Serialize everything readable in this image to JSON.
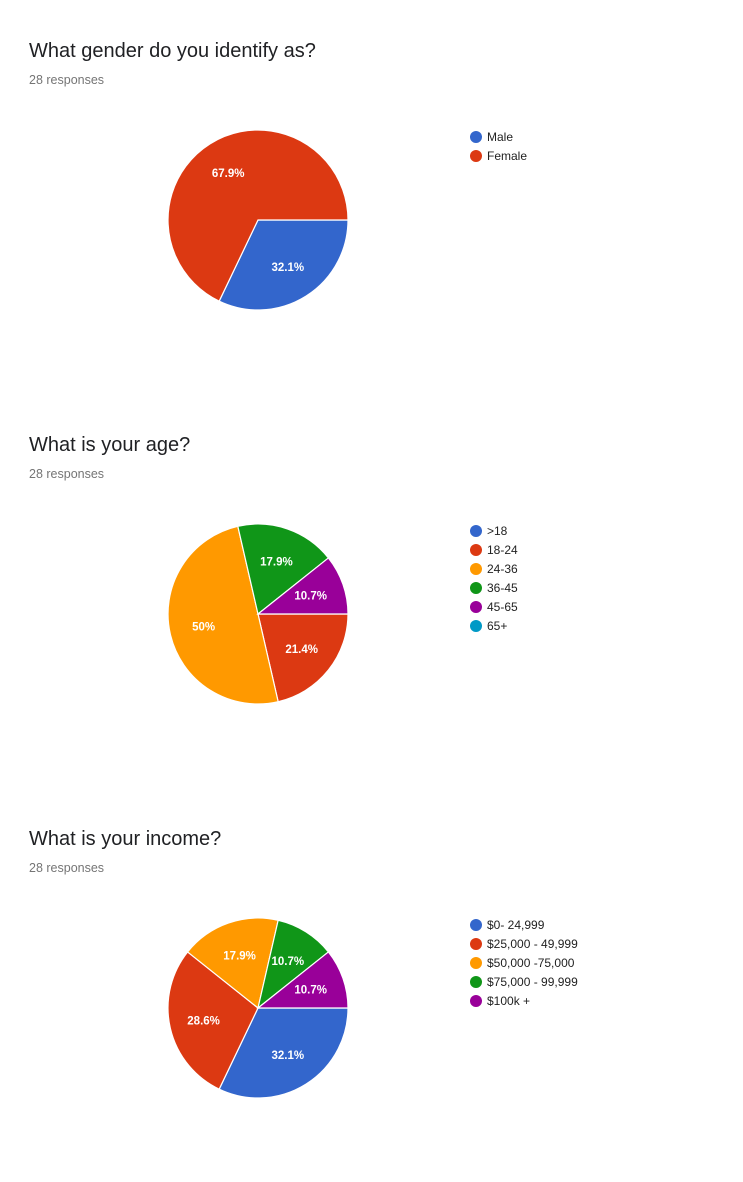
{
  "chart_data": [
    {
      "type": "pie",
      "title": "What gender do you identify as?",
      "subtitle": "28 responses",
      "categories": [
        "Male",
        "Female"
      ],
      "values": [
        32.1,
        67.9
      ],
      "data_labels": [
        "32.1%",
        "67.9%"
      ],
      "colors": [
        "#3366cc",
        "#dc3912"
      ],
      "legend_position": "right",
      "start_angle_deg": 90
    },
    {
      "type": "pie",
      "title": "What is your age?",
      "subtitle": "28 responses",
      "categories": [
        ">18",
        "18-24",
        "24-36",
        "36-45",
        "45-65",
        "65+"
      ],
      "values": [
        0,
        21.4,
        50,
        17.9,
        10.7,
        0
      ],
      "data_labels": [
        "",
        "21.4%",
        "50%",
        "17.9%",
        "10.7%",
        ""
      ],
      "colors": [
        "#3366cc",
        "#dc3912",
        "#ff9900",
        "#109618",
        "#990099",
        "#0099c6"
      ],
      "legend_position": "right",
      "start_angle_deg": 90
    },
    {
      "type": "pie",
      "title": "What is your income?",
      "subtitle": "28 responses",
      "categories": [
        "$0- 24,999",
        "$25,000 - 49,999",
        "$50,000 -75,000",
        "$75,000 - 99,999",
        "$100k +"
      ],
      "values": [
        32.1,
        28.6,
        17.9,
        10.7,
        10.7
      ],
      "data_labels": [
        "32.1%",
        "28.6%",
        "17.9%",
        "10.7%",
        "10.7%"
      ],
      "colors": [
        "#3366cc",
        "#dc3912",
        "#ff9900",
        "#109618",
        "#990099"
      ],
      "legend_position": "right",
      "start_angle_deg": 90
    }
  ]
}
